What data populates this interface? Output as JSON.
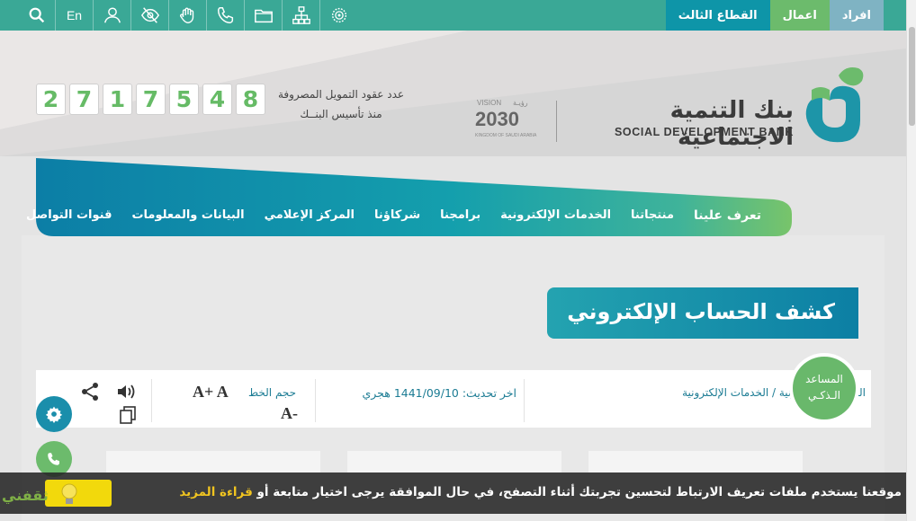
{
  "topbar": {
    "lang": "En",
    "tabs": [
      "افراد",
      "اعمال",
      "القطاع الثالث"
    ],
    "icons": [
      "search-icon",
      "user-icon",
      "eye-off-icon",
      "sign-language-icon",
      "phone-icon",
      "folder-icon",
      "sitemap-icon",
      "settings-badge-icon"
    ]
  },
  "header": {
    "logo_ar": "بنك التنمية الاجتماعية",
    "logo_en": "SOCIAL DEVELOPMENT BANK",
    "vision_ar": "رؤيـة",
    "vision_en": "VISION",
    "vision_year": "2030",
    "vision_country": "KINGDOM OF SAUDI ARABIA",
    "counter_label_1": "عدد عقود التمويل المصروفة",
    "counter_label_2": "منذ تأسيس البنــك",
    "counter_digits": [
      "2",
      "7",
      "1",
      "7",
      "5",
      "4",
      "8"
    ]
  },
  "nav": {
    "items": [
      "تعرف علينا",
      "منتجاتنا",
      "الخدمات الإلكترونية",
      "برامجنا",
      "شركاؤنا",
      "المركز الإعلامي",
      "البيانات والمعلومات",
      "قنوات التواصل"
    ]
  },
  "page": {
    "title": "كشف الحساب الإلكتروني",
    "breadcrumb": "الخدمات الإلكترونية / الخدمات الإلكترونية",
    "update_label": "اخر تحديث:",
    "update_value": "1441/09/10 هجري",
    "font_size_label": "حجم الخط",
    "font_increase": "A+ A",
    "font_decrease": "A-"
  },
  "assistant": {
    "line1": "المساعد",
    "line2": "الـذكـي"
  },
  "cookie": {
    "text": "موقعنا يستخدم ملفات تعريف الارتباط لتحسين تجربتك أثناء التصفح، في حال الموافقة يرجى اختيار متابعة أو ",
    "link": "قراءة المزيد",
    "brand": "ثقفني"
  },
  "colors": {
    "teal": "#3aa896",
    "green": "#6cbb6c",
    "blue": "#0e95a8",
    "accent_yellow": "#f2d90c"
  }
}
